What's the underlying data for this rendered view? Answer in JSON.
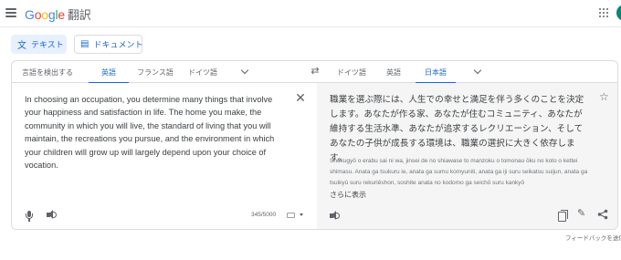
{
  "header": {
    "logo_text": "Google",
    "product_name": "翻訳"
  },
  "modes": {
    "text_label": "テキスト",
    "document_label": "ドキュメント"
  },
  "source_languages": {
    "tabs": [
      "言語を検出する",
      "英語",
      "フランス語",
      "ドイツ語"
    ],
    "active_index": 1
  },
  "target_languages": {
    "tabs": [
      "ドイツ語",
      "英語",
      "日本語"
    ],
    "active_index": 2
  },
  "source": {
    "text": "In choosing an occupation, you determine many things that involve your happiness and satisfaction in life. The home you make, the community in which you will live, the standard of living that you will maintain, the recreations you pursue, and the environment in which your children will grow up will largely depend upon your choice of vocation.",
    "char_count": "345/5000"
  },
  "target": {
    "text": "職業を選ぶ際には、人生での幸せと満足を伴う多くのことを決定します。あなたが作る家、あなたが住むコミュニティ、あなたが維持する生活水準、あなたが追求するレクリエーション、そしてあなたの子供が成長する環境は、職業の選択に大きく依存します。",
    "romanization": "Shokugyō o erabu sai ni wa, jinsei de no shiawase to manzoku o tomonau ōku no koto o kettei shimasu. Anata ga tsukuru ie, anata ga sumu komyuniti, anata ga iji suru seikatsu suijun, anata ga tsuikyū suru rekuriēshon, soshite anata no kodomo ga seichō suru kankyō",
    "show_more": "さらに表示"
  },
  "footer": {
    "feedback": "フィードバックを送信"
  },
  "colors": {
    "accent": "#1967d2",
    "active_mode_bg": "#e8f0fe",
    "target_bg": "#f5f5f5",
    "avatar": "#00897b"
  },
  "icons": [
    "menu-icon",
    "apps-icon",
    "translate-icon",
    "document-icon",
    "swap-icon",
    "chevron-down-icon",
    "close-icon",
    "mic-icon",
    "speaker-icon",
    "keyboard-icon",
    "star-icon",
    "copy-icon",
    "pencil-icon",
    "share-icon"
  ]
}
